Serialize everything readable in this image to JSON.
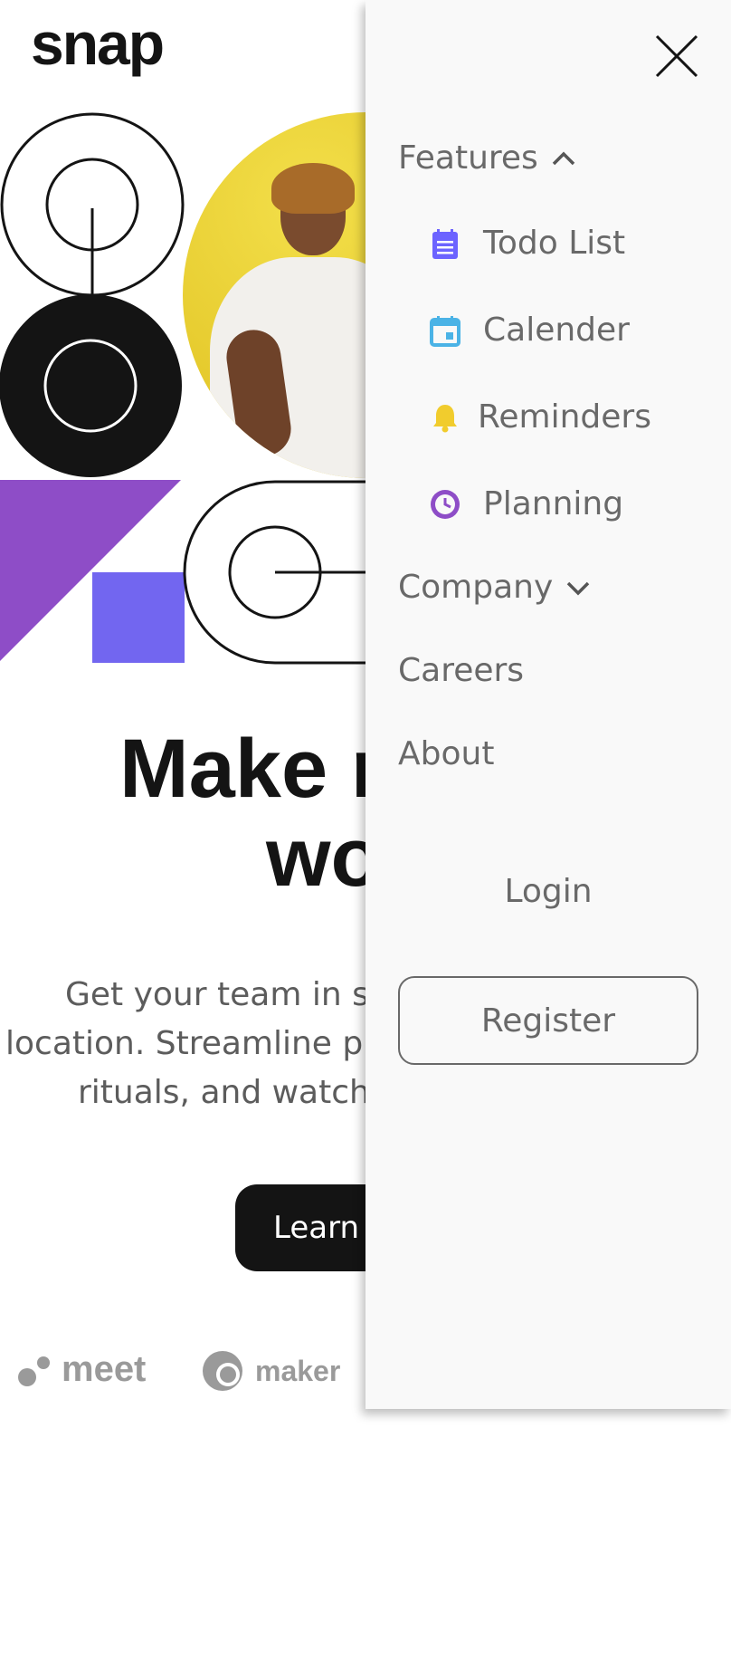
{
  "app": {
    "logo": "snap"
  },
  "hero": {
    "headline_line1": "Make r",
    "headline_line2": "wo",
    "subtext_line1": "Get your team in sy",
    "subtext_line2": "location. Streamline pr",
    "subtext_line3": "rituals, and watch",
    "cta_label": "Learn"
  },
  "brands": [
    {
      "name": "meet"
    },
    {
      "name": "maker"
    }
  ],
  "drawer": {
    "close_icon": "close-icon",
    "features": {
      "label": "Features",
      "expanded": true,
      "items": [
        {
          "label": "Todo List",
          "icon": "todo-list-icon",
          "color": "#6c63ff"
        },
        {
          "label": "Calender",
          "icon": "calendar-icon",
          "color": "#4bb3e6"
        },
        {
          "label": "Reminders",
          "icon": "bell-icon",
          "color": "#f1cc2d"
        },
        {
          "label": "Planning",
          "icon": "clock-icon",
          "color": "#8e4dc7"
        }
      ]
    },
    "company": {
      "label": "Company",
      "expanded": false
    },
    "careers": {
      "label": "Careers"
    },
    "about": {
      "label": "About"
    },
    "login": {
      "label": "Login"
    },
    "register": {
      "label": "Register"
    }
  },
  "colors": {
    "text_dark": "#141414",
    "menu_text": "#696969",
    "drawer_bg": "#f9f9f9",
    "accent_purple": "#8e4dc7",
    "accent_indigo": "#7266f0",
    "accent_yellow": "#e8d02c"
  }
}
